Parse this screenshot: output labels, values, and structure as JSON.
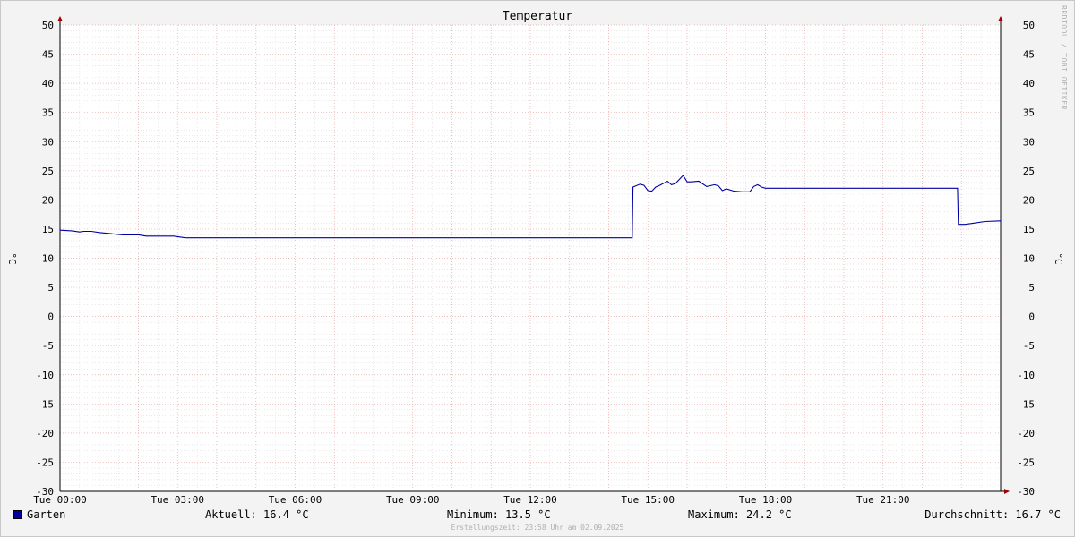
{
  "chart_data": {
    "type": "line",
    "title": "Temperatur",
    "ylabel": "°C",
    "ylim": [
      -30,
      50
    ],
    "yticks": [
      "50",
      "45",
      "40",
      "35",
      "30",
      "25",
      "20",
      "15",
      "10",
      "5",
      "0",
      "-5",
      "-10",
      "-15",
      "-20",
      "-25",
      "-30"
    ],
    "xlim_hours": [
      0,
      24
    ],
    "xticks": [
      "Tue 00:00",
      "Tue 03:00",
      "Tue 06:00",
      "Tue 09:00",
      "Tue 12:00",
      "Tue 15:00",
      "Tue 18:00",
      "Tue 21:00"
    ],
    "grid": true,
    "legend_position": "bottom-left",
    "series": [
      {
        "name": "Garten",
        "color": "#0000a0",
        "x": [
          0,
          0.3,
          0.5,
          0.6,
          0.8,
          1.0,
          1.3,
          1.6,
          1.9,
          2.0,
          2.2,
          2.9,
          3.1,
          3.2,
          5.0,
          10.0,
          14.6,
          14.62,
          14.8,
          14.9,
          15.0,
          15.1,
          15.2,
          15.3,
          15.5,
          15.6,
          15.7,
          15.9,
          16.0,
          16.1,
          16.3,
          16.5,
          16.7,
          16.8,
          16.9,
          17.0,
          17.2,
          17.4,
          17.6,
          17.7,
          17.8,
          17.9,
          18.0,
          20.0,
          22.9,
          22.92,
          23.1,
          23.3,
          23.6,
          24.0
        ],
        "y": [
          14.8,
          14.7,
          14.5,
          14.6,
          14.6,
          14.4,
          14.2,
          14.0,
          14.0,
          14.0,
          13.8,
          13.8,
          13.6,
          13.5,
          13.5,
          13.5,
          13.5,
          22.2,
          22.7,
          22.5,
          21.6,
          21.5,
          22.2,
          22.5,
          23.2,
          22.6,
          22.8,
          24.2,
          23.1,
          23.1,
          23.2,
          22.3,
          22.6,
          22.4,
          21.6,
          21.9,
          21.5,
          21.4,
          21.4,
          22.3,
          22.6,
          22.2,
          22.0,
          22.0,
          22.0,
          15.8,
          15.8,
          16.0,
          16.3,
          16.4
        ]
      }
    ]
  },
  "legend": {
    "series_label": "Garten",
    "current": "Aktuell: 16.4 °C",
    "minimum": "Minimum: 13.5 °C",
    "maximum": "Maximum: 24.2 °C",
    "average": "Durchschnitt: 16.7 °C"
  },
  "watermark": "RRDTOOL / TOBI OETIKER",
  "footer": "Erstellungszeit: 23:58 Uhr am 02.09.2025"
}
